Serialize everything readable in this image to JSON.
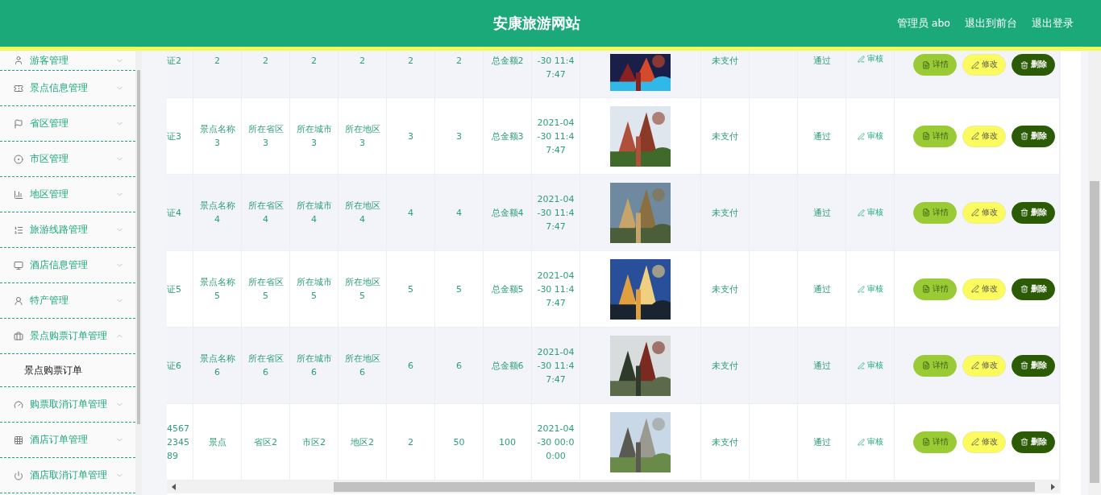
{
  "header": {
    "title": "安康旅游网站",
    "user": "管理员 abo",
    "links": [
      "退出到前台",
      "退出登录"
    ]
  },
  "sidebar": {
    "items": [
      {
        "label": "游客管理",
        "expanded": false
      },
      {
        "label": "景点信息管理",
        "expanded": false
      },
      {
        "label": "省区管理",
        "expanded": false
      },
      {
        "label": "市区管理",
        "expanded": false
      },
      {
        "label": "地区管理",
        "expanded": false
      },
      {
        "label": "旅游线路管理",
        "expanded": false
      },
      {
        "label": "酒店信息管理",
        "expanded": false
      },
      {
        "label": "特产管理",
        "expanded": false
      },
      {
        "label": "景点购票订单管理",
        "expanded": true,
        "children": [
          {
            "label": "景点购票订单",
            "selected": true
          }
        ]
      },
      {
        "label": "购票取消订单管理",
        "expanded": false
      },
      {
        "label": "酒店订单管理",
        "expanded": false
      },
      {
        "label": "酒店取消订单管理",
        "expanded": false
      }
    ]
  },
  "table": {
    "rows": [
      {
        "cells": [
          "证2",
          "2",
          "2",
          "2",
          "2",
          "2",
          "2",
          "总金额2",
          "-30 11:47:47"
        ],
        "pay_state": "未支付",
        "review_state": "通过",
        "review_link": "审核",
        "actions": [
          {
            "kind": "detail",
            "label": "详情"
          },
          {
            "kind": "edit",
            "label": "修改"
          },
          {
            "kind": "delete",
            "label": "删除"
          }
        ]
      },
      {
        "cells": [
          "证3",
          "景点名称3",
          "所在省区3",
          "所在城市3",
          "所在地区3",
          "3",
          "3",
          "总金额3",
          "2021-04-30 11:47:47"
        ],
        "pay_state": "未支付",
        "review_state": "通过",
        "review_link": "审核",
        "actions": [
          {
            "kind": "detail",
            "label": "详情"
          },
          {
            "kind": "edit",
            "label": "修改"
          },
          {
            "kind": "delete",
            "label": "删除"
          }
        ]
      },
      {
        "cells": [
          "证4",
          "景点名称4",
          "所在省区4",
          "所在城市4",
          "所在地区4",
          "4",
          "4",
          "总金额4",
          "2021-04-30 11:47:47"
        ],
        "pay_state": "未支付",
        "review_state": "通过",
        "review_link": "审核",
        "actions": [
          {
            "kind": "detail",
            "label": "详情"
          },
          {
            "kind": "edit",
            "label": "修改"
          },
          {
            "kind": "delete",
            "label": "删除"
          }
        ]
      },
      {
        "cells": [
          "证5",
          "景点名称5",
          "所在省区5",
          "所在城市5",
          "所在地区5",
          "5",
          "5",
          "总金额5",
          "2021-04-30 11:47:47"
        ],
        "pay_state": "未支付",
        "review_state": "通过",
        "review_link": "审核",
        "actions": [
          {
            "kind": "detail",
            "label": "详情"
          },
          {
            "kind": "edit",
            "label": "修改"
          },
          {
            "kind": "delete",
            "label": "删除"
          }
        ]
      },
      {
        "cells": [
          "证6",
          "景点名称6",
          "所在省区6",
          "所在城市6",
          "所在地区6",
          "6",
          "6",
          "总金额6",
          "2021-04-30 11:47:47"
        ],
        "pay_state": "未支付",
        "review_state": "通过",
        "review_link": "审核",
        "actions": [
          {
            "kind": "detail",
            "label": "详情"
          },
          {
            "kind": "edit",
            "label": "修改"
          },
          {
            "kind": "delete",
            "label": "删除"
          }
        ]
      },
      {
        "cells": [
          "4567 2345 89",
          "景点",
          "省区2",
          "市区2",
          "地区2",
          "2",
          "50",
          "100",
          "2021-04-30 00:00:00"
        ],
        "pay_state": "未支付",
        "review_state": "通过",
        "review_link": "审核",
        "actions": [
          {
            "kind": "detail",
            "label": "详情"
          },
          {
            "kind": "edit",
            "label": "修改"
          },
          {
            "kind": "delete",
            "label": "删除"
          }
        ]
      }
    ]
  }
}
